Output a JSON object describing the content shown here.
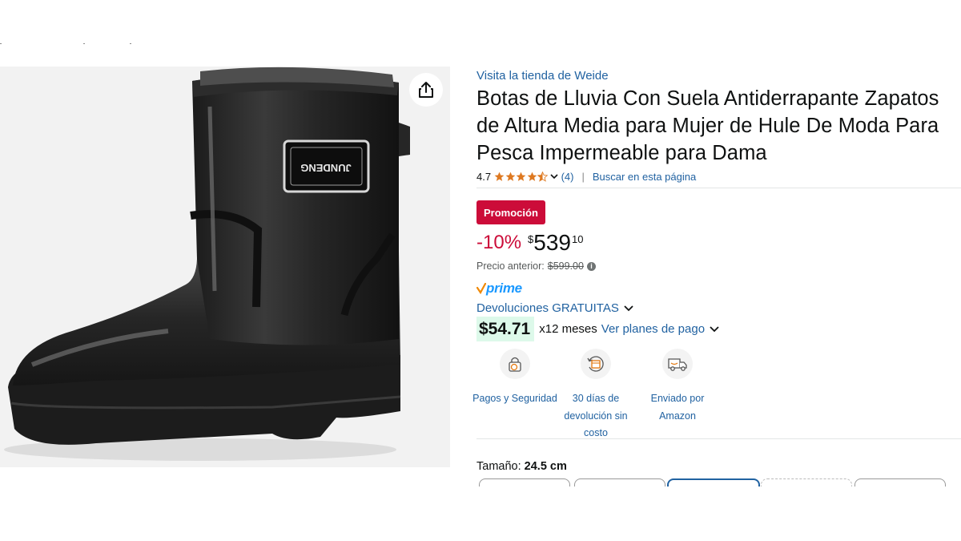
{
  "store_link": "Visita la tienda de Weide",
  "title": "Botas de Lluvia Con Suela Antiderrapante Zapatos de Altura Media para Mujer de Hule De Moda Para Pesca Impermeable para Dama",
  "rating": {
    "value": "4.7",
    "stars": 4.5,
    "review_count": "(4)",
    "search_link": "Buscar en esta página"
  },
  "product_image": {
    "brand_text": "JUNDENG"
  },
  "promo_badge": "Promoción",
  "price": {
    "discount": "-10%",
    "currency_symbol": "$",
    "whole": "539",
    "fraction": "10"
  },
  "previous_price": {
    "label": "Precio anterior:",
    "value": "$599.00"
  },
  "prime_label": "prime",
  "returns_label": "Devoluciones GRATUITAS",
  "installments": {
    "amount": "$54.71",
    "term": "x12 meses",
    "link": "Ver planes de pago"
  },
  "features": [
    {
      "label": "Pagos y Seguridad",
      "icon": "secure-payment-icon"
    },
    {
      "label": "30 días de devolución sin costo",
      "icon": "return-box-icon"
    },
    {
      "label": "Enviado por Amazon",
      "icon": "delivery-truck-icon"
    }
  ],
  "size": {
    "label": "Tamaño:",
    "value": "24.5 cm"
  },
  "colors": {
    "link": "#2162a1",
    "promo": "#cc0c39",
    "star": "#de7921",
    "prime": "#1a98ff",
    "installment_bg": "#ddf9ea"
  }
}
